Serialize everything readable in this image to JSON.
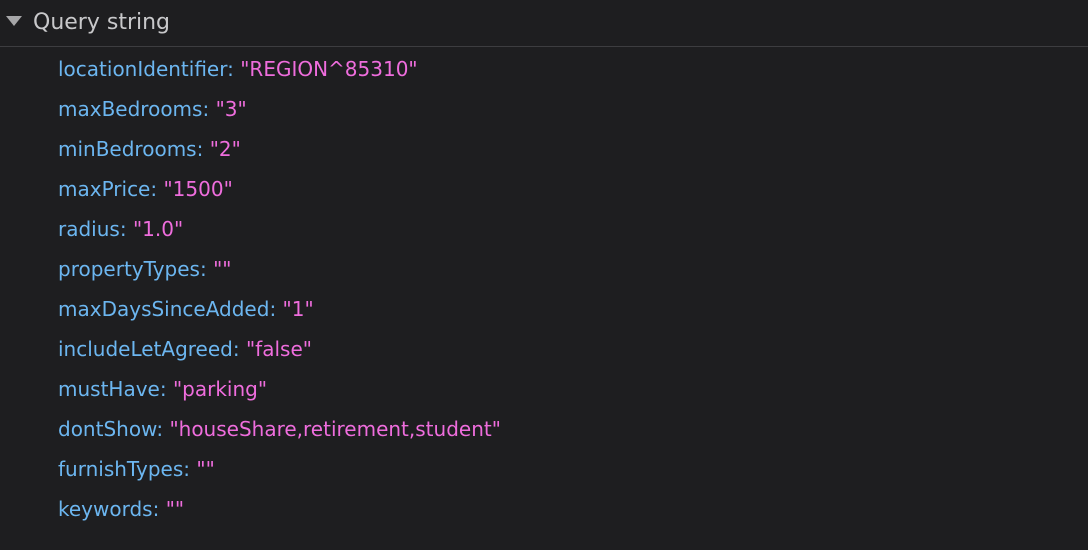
{
  "section": {
    "title": "Query string",
    "icon": "triangle-down-icon"
  },
  "params": [
    {
      "key": "locationIdentifier",
      "value": "\"REGION^85310\""
    },
    {
      "key": "maxBedrooms",
      "value": "\"3\""
    },
    {
      "key": "minBedrooms",
      "value": "\"2\""
    },
    {
      "key": "maxPrice",
      "value": "\"1500\""
    },
    {
      "key": "radius",
      "value": "\"1.0\""
    },
    {
      "key": "propertyTypes",
      "value": "\"\""
    },
    {
      "key": "maxDaysSinceAdded",
      "value": "\"1\""
    },
    {
      "key": "includeLetAgreed",
      "value": "\"false\""
    },
    {
      "key": "mustHave",
      "value": "\"parking\""
    },
    {
      "key": "dontShow",
      "value": "\"houseShare,retirement,student\""
    },
    {
      "key": "furnishTypes",
      "value": "\"\""
    },
    {
      "key": "keywords",
      "value": "\"\""
    }
  ],
  "colors": {
    "background": "#1e1e20",
    "key": "#6cb6f0",
    "value": "#ef6ddd",
    "header_text": "#c8c8ca"
  }
}
